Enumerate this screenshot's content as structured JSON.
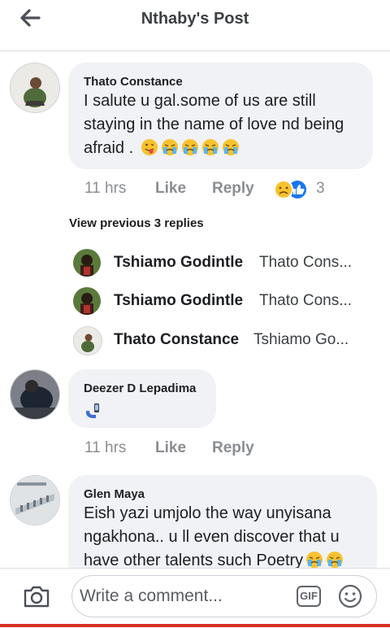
{
  "header": {
    "title": "Nthaby's Post"
  },
  "comments": [
    {
      "author": "Thato Constance",
      "text_line1": "I salute u gal.some of us are still",
      "text_line2": "staying in the name of love nd being",
      "text_line3": "afraid .",
      "time": "11 hrs",
      "like": "Like",
      "reply": "Reply",
      "reaction_count": "3"
    },
    {
      "author": "Deezer D Lepadima",
      "time": "11 hrs",
      "like": "Like",
      "reply": "Reply"
    },
    {
      "author": "Glen Maya",
      "text_line1": "Eish yazi umjolo the way unyisana",
      "text_line2": "ngakhona.. u ll even discover that u",
      "text_line3": "have other talents such Poetry"
    }
  ],
  "view_previous": "View previous 3 replies",
  "replies": [
    {
      "name": "Tshiamo Godintle",
      "preview": "Thato Cons..."
    },
    {
      "name": "Tshiamo Godintle",
      "preview": "Thato Cons..."
    },
    {
      "name": "Thato Constance",
      "preview": "Tshiamo Go..."
    }
  ],
  "composer": {
    "placeholder": "Write a comment...",
    "gif": "GIF"
  },
  "icons": {
    "back": "arrow-left-icon",
    "camera": "camera-icon",
    "gif": "gif-icon",
    "emoji": "smiley-icon"
  }
}
